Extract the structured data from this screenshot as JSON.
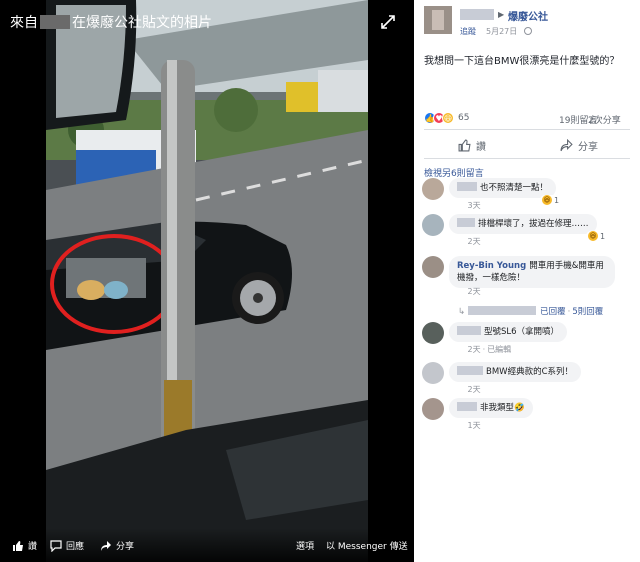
{
  "viewer": {
    "title_prefix": "來自",
    "title_suffix": "在爆廢公社貼文的相片",
    "bottom_bar": {
      "like": "讚",
      "comment": "回應",
      "share": "分享",
      "options": "選項",
      "send_messenger": "以 Messenger 傳送"
    }
  },
  "post": {
    "group_name": "爆廢公社",
    "follow": "追蹤",
    "date": "5月27日",
    "text": "我想問一下這台BMW很漂亮是什麼型號的？",
    "reactions_count": "65",
    "comments_count": "19則留言",
    "shares_count": "2次分享",
    "actions": {
      "like": "讚",
      "share": "分享"
    },
    "more_comments": "檢視另6則留言"
  },
  "comments": [
    {
      "author": "",
      "text": "也不照清楚一點！",
      "time": "3天",
      "react_count": "1"
    },
    {
      "author": "",
      "text": "排檔桿壞了，拔過在修理……",
      "time": "2天",
      "react_count": "1"
    },
    {
      "author": "Rey-Bin Young",
      "text": "開車用手機&開車用機撥，一樣危險！",
      "time": "2天",
      "react_count": ""
    },
    {
      "author": "",
      "text": "型號SL6（拿開噴）",
      "time": "2天",
      "edited": "已編輯",
      "react_count": ""
    },
    {
      "author": "",
      "text": "BMW經典款的C系列！",
      "time": "2天",
      "react_count": ""
    },
    {
      "author": "",
      "text": "非我類型🤣",
      "time": "1天",
      "react_count": ""
    }
  ],
  "reply_row": {
    "replied": "已回覆",
    "replies": "5則回覆"
  },
  "colors": {
    "link": "#385898",
    "bubble": "#f2f3f5",
    "meta": "#90949c",
    "like_blue": "#1877f2",
    "love_red": "#f33e58",
    "haha_yellow": "#f7b928"
  }
}
